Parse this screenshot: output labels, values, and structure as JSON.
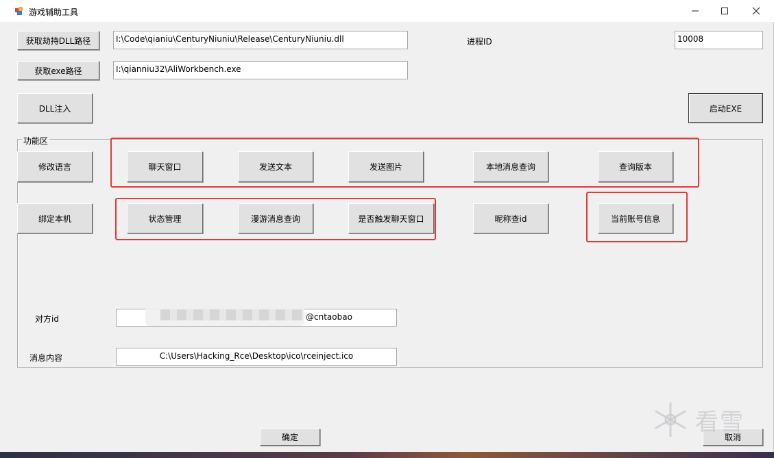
{
  "window": {
    "title": "游戏辅助工具",
    "controls": {
      "minimize": "minimize",
      "maximize": "maximize",
      "close": "close"
    }
  },
  "top": {
    "get_dll_path_label": "获取劫持DLL路径",
    "dll_path_value": "I:\\Code\\qianiu\\CenturyNiuniu\\Release\\CenturyNiuniu.dll",
    "get_exe_path_label": "获取exe路径",
    "exe_path_value": "I:\\qianniu32\\AliWorkbench.exe",
    "process_id_label": "进程ID",
    "process_id_value": "10008",
    "dll_inject_label": "DLL注入",
    "launch_exe_label": "启动EXE"
  },
  "functions": {
    "group_label": "功能区",
    "modify_language": "修改语言",
    "chat_window": "聊天窗口",
    "send_text": "发送文本",
    "send_image": "发送图片",
    "local_msg_query": "本地消息查询",
    "query_version": "查询版本",
    "bind_machine": "绑定本机",
    "status_manage": "状态管理",
    "roam_msg_query": "漫游消息查询",
    "trigger_chat_window": "是否触发聊天窗口",
    "nickname_query_id": "昵称查id",
    "current_account_info": "当前账号信息"
  },
  "fields": {
    "peer_id_label": "对方id",
    "peer_id_value": "@cntaobao",
    "message_label": "消息内容",
    "message_value": "C:\\Users\\Hacking_Rce\\Desktop\\ico\\rceinject.ico"
  },
  "bottom": {
    "ok_label": "确定",
    "cancel_label": "取消"
  },
  "watermark": {
    "text": "看雪"
  },
  "colors": {
    "highlight": "#e53935",
    "window_bg": "#f0f0f0"
  }
}
